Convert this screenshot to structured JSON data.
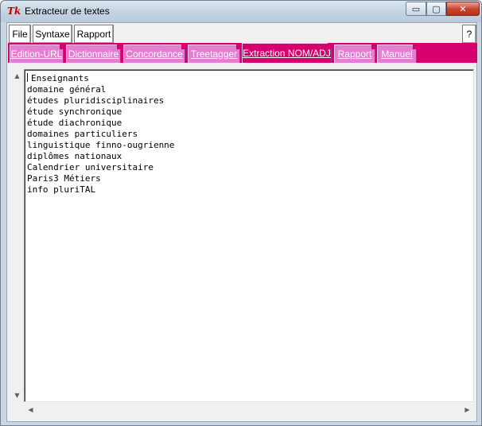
{
  "window": {
    "title": "Extracteur de textes",
    "logo_text": "Tk",
    "minimize_symbol": "▭",
    "maximize_symbol": "▢",
    "close_symbol": "✕"
  },
  "menubar": {
    "items": [
      "File",
      "Syntaxe",
      "Rapport"
    ],
    "help_label": "?"
  },
  "tabs": {
    "items": [
      {
        "label": "Edition-URL"
      },
      {
        "label": "Dictionnaire"
      },
      {
        "label": "Concordance"
      },
      {
        "label": "Treetagger"
      },
      {
        "label": "Extraction NOM/ADJ"
      },
      {
        "label": "Rapport"
      },
      {
        "label": "Manuel"
      }
    ],
    "active": "Extraction NOM/ADJ",
    "colors": {
      "strip": "#d6006f",
      "inactive": "#e27fd0",
      "text": "#ffffff"
    }
  },
  "editor": {
    "lines": [
      "Enseignants",
      "domaine général",
      "études pluridisciplinaires",
      "étude synchronique",
      "étude diachronique",
      "domaines particuliers",
      "linguistique finno-ougrienne",
      "diplômes nationaux",
      "Calendrier universitaire",
      "Paris3 Métiers",
      "info pluriTAL"
    ]
  },
  "scrollbars": {
    "up_arrow": "▲",
    "down_arrow": "▼",
    "left_arrow": "◀",
    "right_arrow": "▶"
  }
}
